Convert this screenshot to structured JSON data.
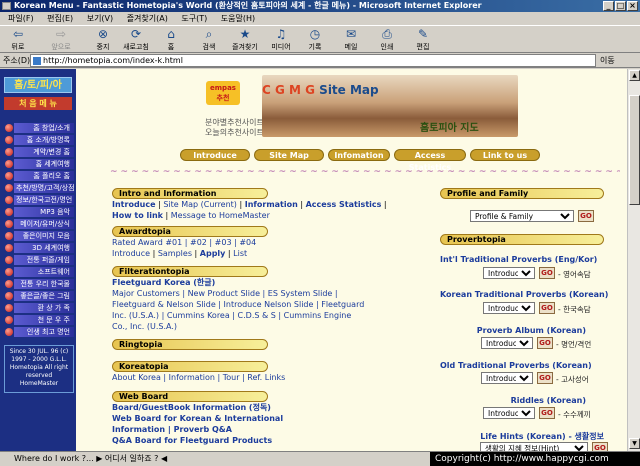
{
  "window": {
    "title": "Korean Menu - Fantastic Hometopia's World (환상적인 홈토피아의 세계 - 한글 메뉴) - Microsoft Internet Explorer",
    "min": "_",
    "max": "□",
    "close": "×"
  },
  "menu": [
    "파일(F)",
    "편집(E)",
    "보기(V)",
    "즐겨찾기(A)",
    "도구(T)",
    "도움말(H)"
  ],
  "toolbar": [
    {
      "label": "뒤로",
      "icon": "back-arrow-icon",
      "glyph": "⇦",
      "disabled": false
    },
    {
      "label": "앞으로",
      "icon": "forward-arrow-icon",
      "glyph": "⇨",
      "disabled": true
    },
    {
      "label": "중지",
      "icon": "stop-icon",
      "glyph": "⊗",
      "disabled": false
    },
    {
      "label": "새로고침",
      "icon": "refresh-icon",
      "glyph": "⟳",
      "disabled": false
    },
    {
      "label": "홈",
      "icon": "home-icon",
      "glyph": "⌂",
      "disabled": false
    },
    {
      "label": "검색",
      "icon": "search-icon",
      "glyph": "⌕",
      "disabled": false
    },
    {
      "label": "즐겨찾기",
      "icon": "favorites-icon",
      "glyph": "★",
      "disabled": false
    },
    {
      "label": "미디어",
      "icon": "media-icon",
      "glyph": "♫",
      "disabled": false
    },
    {
      "label": "기록",
      "icon": "history-icon",
      "glyph": "◷",
      "disabled": false
    },
    {
      "label": "메일",
      "icon": "mail-icon",
      "glyph": "✉",
      "disabled": false
    },
    {
      "label": "인쇄",
      "icon": "print-icon",
      "glyph": "⎙",
      "disabled": false
    },
    {
      "label": "편집",
      "icon": "edit-icon",
      "glyph": "✎",
      "disabled": false
    }
  ],
  "address": {
    "label": "주소(D)",
    "url": "http://hometopia.com/index-k.html",
    "go": "이동"
  },
  "sidebar": {
    "logo": "홈/토/피/아",
    "head": "처 음 메 뉴",
    "items": [
      "홈 창업/소개",
      "홈 소개/방명록",
      "계약/변경 홈",
      "홈 세계여행",
      "홈 폴리오 홈",
      "추천/방명/고객/상점",
      "정보/한국고전/명언",
      "MP3 음악",
      "메이저/유머/상식",
      "좋은이미지 모음",
      "3D 세계여행",
      "전통 퍼즐/게임",
      "소프트웨어",
      "전통 우리 한국물",
      "좋은글/좋은 그림",
      "환 상 가 족",
      "천 문 우 주",
      "인생 최고 명언"
    ],
    "copyright": "Since 30 JUL. 96 (c) 1997 - 2000 G.L.L. Hometopia All right reserved HomeMaster"
  },
  "banner": {
    "empas": "empas 추천",
    "rec1": "분야별추천사이트",
    "rec2": "오늘의추천사이트",
    "title_cm": "C G M G",
    "title": "Site Map",
    "subtitle": "홈토피아 지도"
  },
  "nav": [
    "Introduce",
    "Site Map",
    "Infomation",
    "Access Statistics",
    "Link to us"
  ],
  "swirl": "~~~~~~~~~~~~~~~~~~~~~~~~~~~~~~~~~~~~~~~~~~~~~~~~~~~~~~~~~~~~~~~~~~~~~~~~~~~~~~~",
  "left": {
    "intro": {
      "title": "Intro and Information",
      "l1a": "Introduce",
      "l1b": "Site Map (Current)",
      "l1c": "Information",
      "l1d": "Access Statistics",
      "l2a": "How to link",
      "l2b": "Message to HomeMaster"
    },
    "award": {
      "title": "Awardtopia",
      "l1": "Rated Award #01 | #02 | #03 | #04",
      "l2a": "Introduce",
      "l2b": "Samples",
      "l2c": "Apply",
      "l2d": "List"
    },
    "filter": {
      "title": "Filterationtopia",
      "l1": "Fleetguard Korea (한글)",
      "l2": "Major Customers | New Product Slide | ES System Slide |",
      "l3": "Fleetguard & Nelson Slide | Introduce Nelson Slide | Fleetguard",
      "l4": "Inc. (U.S.A.) | Cummins Korea | C.D.S & S | Cummins Engine",
      "l5": "Co., Inc. (U.S.A.)"
    },
    "ring": {
      "title": "Ringtopia"
    },
    "korea": {
      "title": "Koreatopia",
      "l1": "About Korea | Information | Tour | Ref. Links"
    },
    "web": {
      "title": "Web Board",
      "l1": "Board/GuestBook Information (정독)",
      "l2": "Web Board for Korean & International",
      "l3": "Information | Proverb Q&A",
      "l4": "Q&A Board for Fleetguard Products"
    }
  },
  "right": {
    "profile": {
      "title": "Profile and Family",
      "select": "Profile & Family",
      "go": "GO"
    },
    "proverb": {
      "title": "Proverbtopia"
    },
    "items": [
      {
        "title": "Int'l Traditional Proverbs (Eng/Kor)",
        "select": "Introduce",
        "go": "GO",
        "hint": "- 영어속담"
      },
      {
        "title": "Korean Traditional Proverbs (Korean)",
        "select": "Introduce",
        "go": "GO",
        "hint": "- 한국속담"
      },
      {
        "title": "Proverb Album (Korean)",
        "select": "Introduce",
        "go": "GO",
        "hint": "- 명언/격언"
      },
      {
        "title": "Old Traditional Proverbs (Korean)",
        "select": "Introduce",
        "go": "GO",
        "hint": "- 고사성어"
      },
      {
        "title": "Riddles (Korean)",
        "select": "Introduce",
        "go": "GO",
        "hint": "- 수수께끼"
      },
      {
        "title": "Life Hints (Korean) - 생활정보",
        "select": "생활의 지혜 정보(Hint)",
        "go": "GO",
        "hint": ""
      }
    ]
  },
  "status": {
    "text": "Where do I work ?... ▶ 어디서 일하죠 ? ◀",
    "copyright": "Copyright(c) http://www.happycgi.com"
  }
}
